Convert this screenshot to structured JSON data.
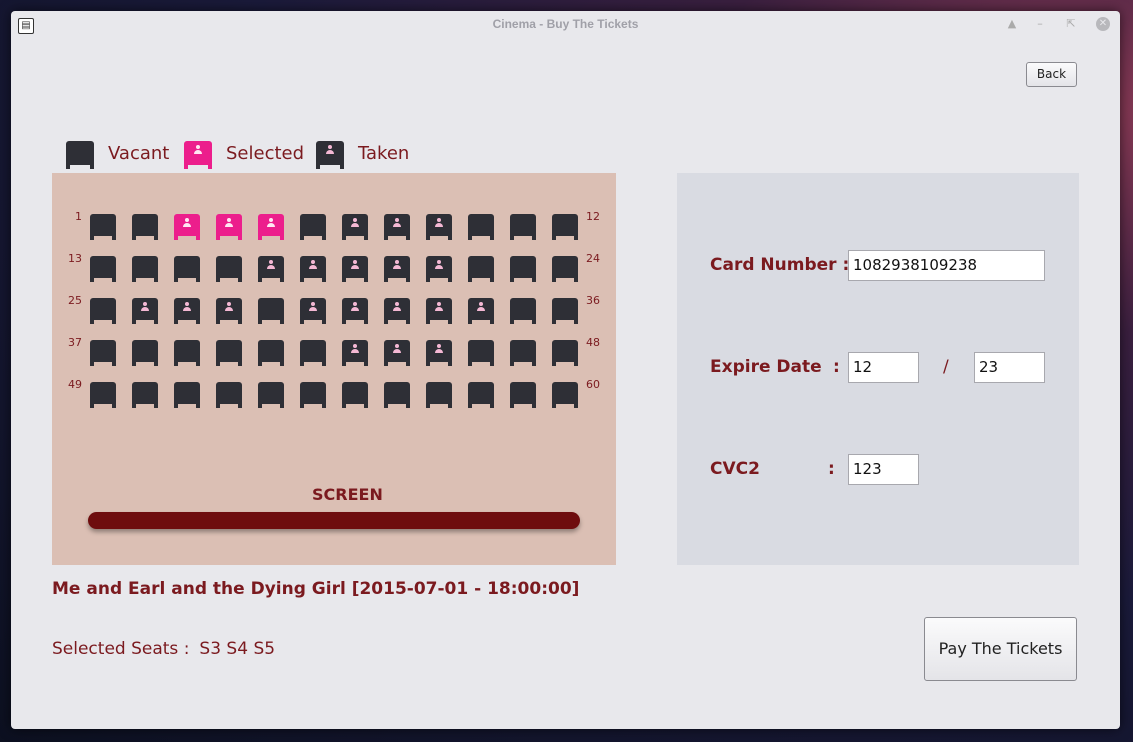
{
  "window": {
    "title": "Cinema - Buy The Tickets",
    "controls": [
      "shade",
      "minimize",
      "maximize",
      "close"
    ]
  },
  "back_label": "Back",
  "legend": {
    "vacant": "Vacant",
    "selected": "Selected",
    "taken": "Taken"
  },
  "hall": {
    "row_start_numbers": [
      "1",
      "13",
      "25",
      "37",
      "49"
    ],
    "row_end_numbers": [
      "12",
      "24",
      "36",
      "48",
      "60"
    ],
    "seat_states": [
      [
        "vacant",
        "vacant",
        "selected",
        "selected",
        "selected",
        "vacant",
        "taken",
        "taken",
        "taken",
        "vacant",
        "vacant",
        "vacant"
      ],
      [
        "vacant",
        "vacant",
        "vacant",
        "vacant",
        "taken",
        "taken",
        "taken",
        "taken",
        "taken",
        "vacant",
        "vacant",
        "vacant"
      ],
      [
        "vacant",
        "taken",
        "taken",
        "taken",
        "vacant",
        "taken",
        "taken",
        "taken",
        "taken",
        "taken",
        "vacant",
        "vacant"
      ],
      [
        "vacant",
        "vacant",
        "vacant",
        "vacant",
        "vacant",
        "vacant",
        "taken",
        "taken",
        "taken",
        "vacant",
        "vacant",
        "vacant"
      ],
      [
        "vacant",
        "vacant",
        "vacant",
        "vacant",
        "vacant",
        "vacant",
        "vacant",
        "vacant",
        "vacant",
        "vacant",
        "vacant",
        "vacant"
      ]
    ],
    "screen_label": "SCREEN",
    "colors": {
      "vacant": "#2e2f36",
      "selected": "#ec1e8c",
      "panel": "#dbbfb4",
      "screen": "#6e0d0e"
    }
  },
  "movie": {
    "title": "Me and Earl and the Dying Girl [2015-07-01 - 18:00:00]"
  },
  "selected_seats": {
    "label": "Selected Seats :",
    "value": "S3 S4 S5"
  },
  "payment": {
    "card_label": "Card Number :",
    "card_value": "1082938109238",
    "expire_label": "Expire Date",
    "expire_colon": ":",
    "expire_month": "12",
    "expire_sep": "/",
    "expire_year": "23",
    "cvc_label": "CVC2",
    "cvc_colon": ":",
    "cvc_value": "123"
  },
  "pay_label": "Pay The Tickets",
  "accent_color": "#7b1a1f"
}
